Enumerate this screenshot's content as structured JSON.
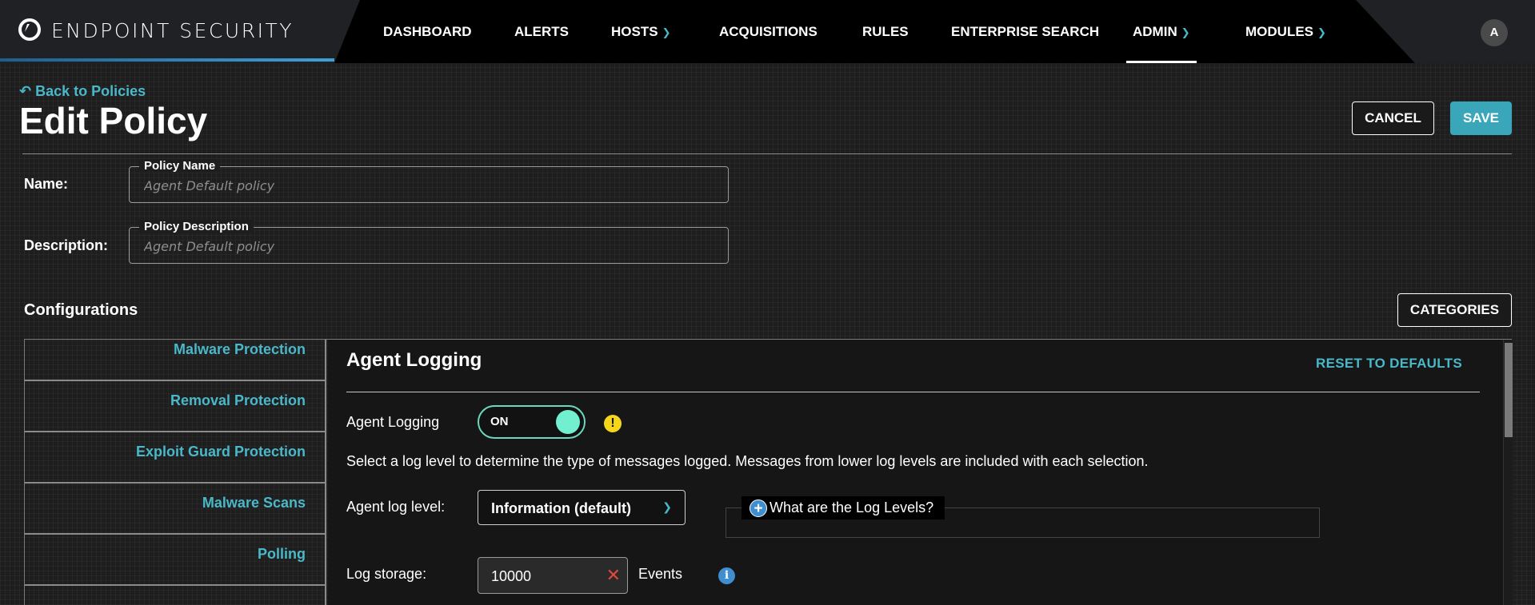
{
  "app": {
    "brand_title": "ENDPOINT SECURITY",
    "user_initial": "A"
  },
  "nav": {
    "items": [
      {
        "label": "DASHBOARD",
        "dropdown": false
      },
      {
        "label": "ALERTS",
        "dropdown": false
      },
      {
        "label": "HOSTS",
        "dropdown": true
      },
      {
        "label": "ACQUISITIONS",
        "dropdown": false
      },
      {
        "label": "RULES",
        "dropdown": false
      },
      {
        "label": "ENTERPRISE SEARCH",
        "dropdown": false
      },
      {
        "label": "ADMIN",
        "dropdown": true,
        "active": true
      },
      {
        "label": "MODULES",
        "dropdown": true
      }
    ]
  },
  "header": {
    "back_label": "Back to Policies",
    "title": "Edit Policy",
    "cancel_label": "CANCEL",
    "save_label": "SAVE"
  },
  "form": {
    "name_label": "Name:",
    "name_legend": "Policy Name",
    "name_placeholder": "Agent Default policy",
    "name_value": "",
    "description_label": "Description:",
    "description_legend": "Policy Description",
    "description_placeholder": "Agent Default policy",
    "description_value": ""
  },
  "configurations": {
    "title": "Configurations",
    "categories_label": "CATEGORIES",
    "sidebar": [
      {
        "label": "Malware Protection"
      },
      {
        "label": "Removal Protection"
      },
      {
        "label": "Exploit Guard Protection"
      },
      {
        "label": "Malware Scans"
      },
      {
        "label": "Polling"
      }
    ],
    "panel": {
      "title": "Agent Logging",
      "reset_label": "RESET TO DEFAULTS",
      "toggle_label": "Agent Logging",
      "toggle_state": "ON",
      "help_text": "Select a log level to determine the type of messages logged. Messages from lower log levels are included with each selection.",
      "log_level_label": "Agent log level:",
      "log_level_value": "Information (default)",
      "log_levels_help": "What are the Log Levels?",
      "log_storage_label": "Log storage:",
      "log_storage_value": "10000",
      "log_storage_unit": "Events"
    }
  },
  "colors": {
    "accent": "#49b8c9",
    "primary_button": "#3aa6b9",
    "toggle_on": "#72efcf",
    "warning": "#f5d61b",
    "info": "#3e8ed0",
    "clear": "#e04a3a"
  },
  "icons": {
    "logo": "endpoint-logo-icon",
    "back": "back-arrow-icon",
    "chevron": "chevron-down-icon",
    "warning": "warning-icon",
    "expand": "plus-circle-icon",
    "clear": "clear-x-icon",
    "info": "info-icon"
  }
}
